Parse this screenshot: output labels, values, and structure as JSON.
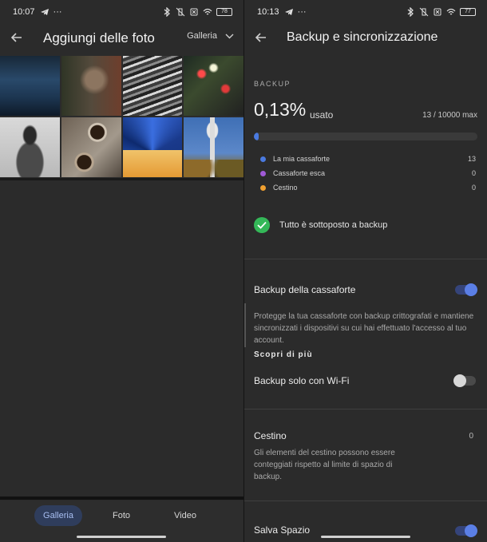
{
  "left": {
    "status": {
      "time": "10:07",
      "battery": "78"
    },
    "appbar": {
      "title": "Aggiungi delle foto",
      "dropdown_label": "Galleria"
    },
    "photos": [
      {
        "icon": "photo-sea"
      },
      {
        "icon": "photo-coyote"
      },
      {
        "icon": "photo-rocks"
      },
      {
        "icon": "photo-neon-signs"
      },
      {
        "icon": "photo-person"
      },
      {
        "icon": "photo-coffee"
      },
      {
        "icon": "photo-building"
      },
      {
        "icon": "photo-space-needle"
      }
    ],
    "bottom_nav": {
      "tabs": [
        "Galleria",
        "Foto",
        "Video"
      ],
      "active": "Galleria"
    }
  },
  "right": {
    "status": {
      "time": "10:13",
      "battery": "77"
    },
    "appbar": {
      "title": "Backup e sincronizzazione"
    },
    "backup": {
      "section_label": "BACKUP",
      "usage_percent": "0,13%",
      "usage_label": "usato",
      "usage_count": "13 / 10000 max",
      "usage_fraction": 0.0013,
      "legend": [
        {
          "label": "La mia cassaforte",
          "count": "13",
          "color": "#4a7ae0"
        },
        {
          "label": "Cassaforte esca",
          "count": "0",
          "color": "#a05ad6"
        },
        {
          "label": "Cestino",
          "count": "0",
          "color": "#f0a030"
        }
      ],
      "status_text": "Tutto è sottoposto a backup"
    },
    "settings": {
      "vault_backup": {
        "title": "Backup della cassaforte",
        "desc": "Protegge la tua cassaforte con backup crittografati e mantiene sincronizzati i dispositivi su cui hai effettuato l'accesso al tuo account.",
        "link": "Scopri di più",
        "enabled": true
      },
      "wifi_only": {
        "title": "Backup solo con Wi-Fi",
        "enabled": false
      },
      "trash": {
        "title": "Cestino",
        "count": "0",
        "desc": "Gli elementi del cestino possono essere conteggiati rispetto al limite di spazio di backup."
      },
      "save_space": {
        "title": "Salva Spazio",
        "enabled": true
      }
    }
  }
}
